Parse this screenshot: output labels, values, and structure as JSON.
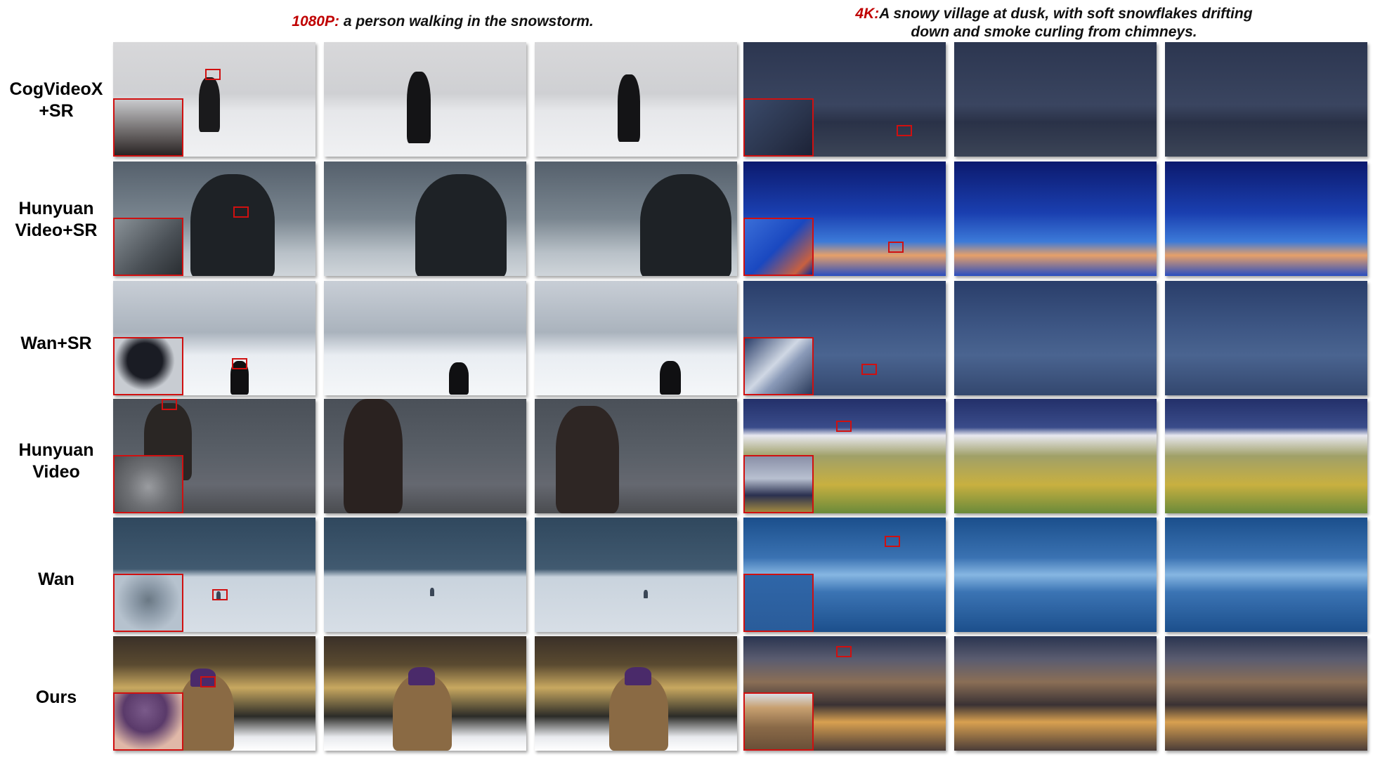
{
  "captions": {
    "left_tag": "1080P:",
    "left_text": " a person walking in the snowstorm.",
    "right_tag": "4K:",
    "right_text_line1": "A snowy village at dusk, with soft snowflakes drifting",
    "right_text_line2": "down and smoke curling from chimneys."
  },
  "rows": [
    {
      "label_line1": "CogVideoX",
      "label_line2": "+SR"
    },
    {
      "label_line1": "Hunyuan",
      "label_line2": "Video+SR"
    },
    {
      "label_line1": "Wan+SR",
      "label_line2": ""
    },
    {
      "label_line1": "Hunyuan",
      "label_line2": "Video"
    },
    {
      "label_line1": "Wan",
      "label_line2": ""
    },
    {
      "label_line1": "Ours",
      "label_line2": ""
    }
  ],
  "colors": {
    "accent_red": "#c00000",
    "zoom_box": "#d01010"
  }
}
